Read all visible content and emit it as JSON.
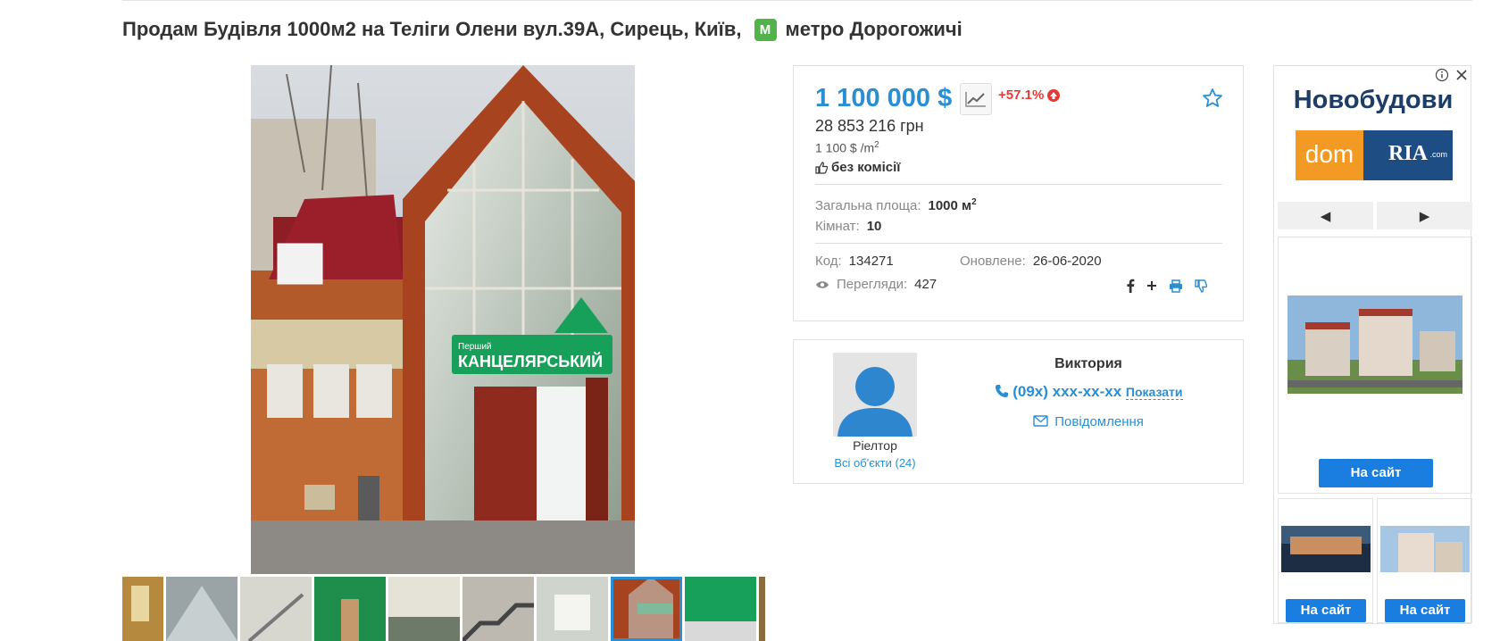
{
  "listing": {
    "title": "Продам Будівля 1000м2 на Теліги Олени вул.39А, Сирець, Київ,",
    "metro": "метро Дорогожичі",
    "metro_badge": "M"
  },
  "price": {
    "usd": "1 100 000 $",
    "change": "+57.1%",
    "uah": "28 853 216 грн",
    "per_m": "1 100 $ /m",
    "per_m_sup": "2",
    "no_commission": "без комісії"
  },
  "details": {
    "area_label": "Загальна площа:",
    "area_value": "1000 м",
    "area_sup": "2",
    "rooms_label": "Кімнат:",
    "rooms_value": "10",
    "code_label": "Код:",
    "code_value": "134271",
    "updated_label": "Оновлене:",
    "updated_value": "26-06-2020",
    "views_label": "Перегляди:",
    "views_value": "427"
  },
  "seller": {
    "name": "Виктория",
    "phone": "(09x) xxx-xx-xx",
    "show_label": "Показати",
    "message_label": "Повідомлення",
    "role": "Ріелтор",
    "all_objects": "Всі об'єкти (24)"
  },
  "ad": {
    "title": "Новобудови",
    "dom": "dom",
    "ria": "RIA",
    "ria_com": ".com",
    "prev": "◀",
    "next": "▶",
    "cta_main": "На сайт",
    "cta_left": "На сайт",
    "cta_right": "На сайт"
  },
  "colors": {
    "accent": "#2a8fd2",
    "up": "#e53935",
    "metro": "#52b34b",
    "signboard": "#16a05a",
    "cta": "#1a7ee0"
  }
}
